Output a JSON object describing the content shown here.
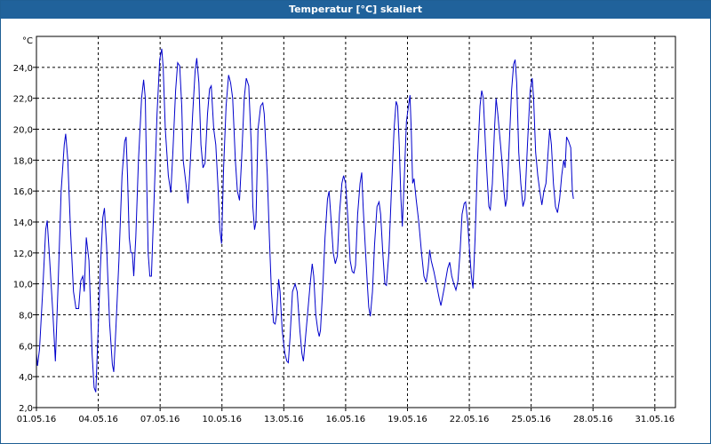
{
  "window": {
    "title": "Temperatur [°C] skaliert"
  },
  "chart_data": {
    "type": "line",
    "title": "Temperatur [°C] skaliert",
    "unit_label": "°C",
    "xlabel": "",
    "ylabel": "°C",
    "ylim": [
      2,
      26
    ],
    "xlim_days": [
      0,
      31
    ],
    "grid": true,
    "line_color": "#0000cc",
    "y_ticks": [
      "2,0",
      "4,0",
      "6,0",
      "8,0",
      "10,0",
      "12,0",
      "14,0",
      "16,0",
      "18,0",
      "20,0",
      "22,0",
      "24,0"
    ],
    "x_ticks": [
      {
        "day": 0,
        "label": "01.05.16"
      },
      {
        "day": 3,
        "label": "04.05.16"
      },
      {
        "day": 6,
        "label": "07.05.16"
      },
      {
        "day": 9,
        "label": "10.05.16"
      },
      {
        "day": 12,
        "label": "13.05.16"
      },
      {
        "day": 15,
        "label": "16.05.16"
      },
      {
        "day": 18,
        "label": "19.05.16"
      },
      {
        "day": 21,
        "label": "22.05.16"
      },
      {
        "day": 24,
        "label": "25.05.16"
      },
      {
        "day": 27,
        "label": "28.05.16"
      },
      {
        "day": 30,
        "label": "31.05.16"
      }
    ],
    "series": [
      {
        "points": [
          [
            0.0,
            5.5
          ],
          [
            0.05,
            4.7
          ],
          [
            0.15,
            5.8
          ],
          [
            0.3,
            9.5
          ],
          [
            0.45,
            13.5
          ],
          [
            0.52,
            14.1
          ],
          [
            0.62,
            12.0
          ],
          [
            0.8,
            8.0
          ],
          [
            0.92,
            5.0
          ],
          [
            1.05,
            10.0
          ],
          [
            1.2,
            16.0
          ],
          [
            1.35,
            19.0
          ],
          [
            1.42,
            19.7
          ],
          [
            1.52,
            18.0
          ],
          [
            1.65,
            13.5
          ],
          [
            1.8,
            9.5
          ],
          [
            1.92,
            8.4
          ],
          [
            2.05,
            8.4
          ],
          [
            2.15,
            10.2
          ],
          [
            2.25,
            10.5
          ],
          [
            2.32,
            9.5
          ],
          [
            2.42,
            13.0
          ],
          [
            2.55,
            11.5
          ],
          [
            2.7,
            5.5
          ],
          [
            2.8,
            3.3
          ],
          [
            2.88,
            3.0
          ],
          [
            2.98,
            6.5
          ],
          [
            3.1,
            11.0
          ],
          [
            3.22,
            14.3
          ],
          [
            3.3,
            14.9
          ],
          [
            3.4,
            12.5
          ],
          [
            3.55,
            7.5
          ],
          [
            3.68,
            4.8
          ],
          [
            3.75,
            4.3
          ],
          [
            3.85,
            7.0
          ],
          [
            4.0,
            11.5
          ],
          [
            4.15,
            17.0
          ],
          [
            4.28,
            19.2
          ],
          [
            4.35,
            19.5
          ],
          [
            4.42,
            17.0
          ],
          [
            4.5,
            13.0
          ],
          [
            4.58,
            12.0
          ],
          [
            4.65,
            12.0
          ],
          [
            4.72,
            10.5
          ],
          [
            4.82,
            13.0
          ],
          [
            4.95,
            18.0
          ],
          [
            5.1,
            22.0
          ],
          [
            5.2,
            23.2
          ],
          [
            5.28,
            22.0
          ],
          [
            5.35,
            16.5
          ],
          [
            5.42,
            12.0
          ],
          [
            5.5,
            10.5
          ],
          [
            5.58,
            10.5
          ],
          [
            5.72,
            16.0
          ],
          [
            5.85,
            21.0
          ],
          [
            5.98,
            24.5
          ],
          [
            6.08,
            25.2
          ],
          [
            6.15,
            24.0
          ],
          [
            6.25,
            20.0
          ],
          [
            6.4,
            17.0
          ],
          [
            6.52,
            15.9
          ],
          [
            6.62,
            18.5
          ],
          [
            6.75,
            22.5
          ],
          [
            6.85,
            24.3
          ],
          [
            6.95,
            24.1
          ],
          [
            7.05,
            21.5
          ],
          [
            7.12,
            18.0
          ],
          [
            7.25,
            16.5
          ],
          [
            7.35,
            15.2
          ],
          [
            7.45,
            17.5
          ],
          [
            7.58,
            21.0
          ],
          [
            7.7,
            23.8
          ],
          [
            7.78,
            24.6
          ],
          [
            7.88,
            23.0
          ],
          [
            7.98,
            19.0
          ],
          [
            8.08,
            17.5
          ],
          [
            8.18,
            17.8
          ],
          [
            8.3,
            21.0
          ],
          [
            8.4,
            22.6
          ],
          [
            8.48,
            22.8
          ],
          [
            8.6,
            20.0
          ],
          [
            8.7,
            19.0
          ],
          [
            8.8,
            16.5
          ],
          [
            8.9,
            13.5
          ],
          [
            8.98,
            12.6
          ],
          [
            9.08,
            17.5
          ],
          [
            9.2,
            21.5
          ],
          [
            9.32,
            23.5
          ],
          [
            9.42,
            23.0
          ],
          [
            9.52,
            22.0
          ],
          [
            9.65,
            18.0
          ],
          [
            9.75,
            16.0
          ],
          [
            9.85,
            15.4
          ],
          [
            9.95,
            18.0
          ],
          [
            10.08,
            22.0
          ],
          [
            10.18,
            23.3
          ],
          [
            10.3,
            22.8
          ],
          [
            10.42,
            19.0
          ],
          [
            10.5,
            15.0
          ],
          [
            10.58,
            13.5
          ],
          [
            10.65,
            14.0
          ],
          [
            10.75,
            20.0
          ],
          [
            10.88,
            21.5
          ],
          [
            10.98,
            21.7
          ],
          [
            11.05,
            21.0
          ],
          [
            11.2,
            17.0
          ],
          [
            11.3,
            13.0
          ],
          [
            11.4,
            9.5
          ],
          [
            11.5,
            7.5
          ],
          [
            11.58,
            7.4
          ],
          [
            11.65,
            8.0
          ],
          [
            11.75,
            10.3
          ],
          [
            11.82,
            9.5
          ],
          [
            11.92,
            7.0
          ],
          [
            12.05,
            5.5
          ],
          [
            12.15,
            5.0
          ],
          [
            12.22,
            4.9
          ],
          [
            12.3,
            6.5
          ],
          [
            12.42,
            9.5
          ],
          [
            12.55,
            10.0
          ],
          [
            12.65,
            9.5
          ],
          [
            12.78,
            7.0
          ],
          [
            12.88,
            5.5
          ],
          [
            12.95,
            5.0
          ],
          [
            13.05,
            6.5
          ],
          [
            13.15,
            8.0
          ],
          [
            13.28,
            10.0
          ],
          [
            13.38,
            11.3
          ],
          [
            13.45,
            10.5
          ],
          [
            13.55,
            8.0
          ],
          [
            13.65,
            7.0
          ],
          [
            13.72,
            6.6
          ],
          [
            13.78,
            7.0
          ],
          [
            13.9,
            10.0
          ],
          [
            14.0,
            13.0
          ],
          [
            14.12,
            15.5
          ],
          [
            14.2,
            16.0
          ],
          [
            14.3,
            14.0
          ],
          [
            14.4,
            12.0
          ],
          [
            14.5,
            11.3
          ],
          [
            14.6,
            11.8
          ],
          [
            14.7,
            14.5
          ],
          [
            14.82,
            16.5
          ],
          [
            14.9,
            17.0
          ],
          [
            15.0,
            16.5
          ],
          [
            15.12,
            14.0
          ],
          [
            15.22,
            11.5
          ],
          [
            15.32,
            10.8
          ],
          [
            15.4,
            10.7
          ],
          [
            15.48,
            11.2
          ],
          [
            15.58,
            14.5
          ],
          [
            15.7,
            16.5
          ],
          [
            15.78,
            17.2
          ],
          [
            15.85,
            15.0
          ],
          [
            15.95,
            12.5
          ],
          [
            16.05,
            10.0
          ],
          [
            16.12,
            8.5
          ],
          [
            16.2,
            7.9
          ],
          [
            16.3,
            9.5
          ],
          [
            16.4,
            12.5
          ],
          [
            16.52,
            15.0
          ],
          [
            16.62,
            15.3
          ],
          [
            16.7,
            14.5
          ],
          [
            16.8,
            12.0
          ],
          [
            16.9,
            10.0
          ],
          [
            16.98,
            9.9
          ],
          [
            17.1,
            12.0
          ],
          [
            17.22,
            16.0
          ],
          [
            17.35,
            20.0
          ],
          [
            17.45,
            21.8
          ],
          [
            17.52,
            21.5
          ],
          [
            17.6,
            19.0
          ],
          [
            17.68,
            15.5
          ],
          [
            17.75,
            13.7
          ],
          [
            17.85,
            17.0
          ],
          [
            17.95,
            20.5
          ],
          [
            18.05,
            21.5
          ],
          [
            18.12,
            22.2
          ],
          [
            18.18,
            20.0
          ],
          [
            18.25,
            16.5
          ],
          [
            18.32,
            16.8
          ],
          [
            18.42,
            15.5
          ],
          [
            18.55,
            14.0
          ],
          [
            18.68,
            12.0
          ],
          [
            18.8,
            10.5
          ],
          [
            18.9,
            10.1
          ],
          [
            19.0,
            11.0
          ],
          [
            19.08,
            12.2
          ],
          [
            19.15,
            11.5
          ],
          [
            19.28,
            10.8
          ],
          [
            19.4,
            10.0
          ],
          [
            19.55,
            9.0
          ],
          [
            19.62,
            8.6
          ],
          [
            19.72,
            9.3
          ],
          [
            19.82,
            10.0
          ],
          [
            19.95,
            11.0
          ],
          [
            20.05,
            11.4
          ],
          [
            20.15,
            10.5
          ],
          [
            20.25,
            10.0
          ],
          [
            20.35,
            9.6
          ],
          [
            20.45,
            10.2
          ],
          [
            20.55,
            12.0
          ],
          [
            20.65,
            14.5
          ],
          [
            20.75,
            15.2
          ],
          [
            20.82,
            15.3
          ],
          [
            20.92,
            14.0
          ],
          [
            21.02,
            12.0
          ],
          [
            21.1,
            10.5
          ],
          [
            21.18,
            9.7
          ],
          [
            21.28,
            13.0
          ],
          [
            21.4,
            18.0
          ],
          [
            21.52,
            21.5
          ],
          [
            21.6,
            22.5
          ],
          [
            21.68,
            22.0
          ],
          [
            21.78,
            19.0
          ],
          [
            21.88,
            16.5
          ],
          [
            21.95,
            15.0
          ],
          [
            22.02,
            14.8
          ],
          [
            22.12,
            16.5
          ],
          [
            22.22,
            20.0
          ],
          [
            22.3,
            22.0
          ],
          [
            22.38,
            21.0
          ],
          [
            22.48,
            19.5
          ],
          [
            22.58,
            18.0
          ],
          [
            22.68,
            16.0
          ],
          [
            22.75,
            15.0
          ],
          [
            22.82,
            15.5
          ],
          [
            22.92,
            18.5
          ],
          [
            23.05,
            22.5
          ],
          [
            23.15,
            24.2
          ],
          [
            23.22,
            24.5
          ],
          [
            23.3,
            23.0
          ],
          [
            23.4,
            18.5
          ],
          [
            23.5,
            16.5
          ],
          [
            23.6,
            15.0
          ],
          [
            23.7,
            15.5
          ],
          [
            23.82,
            19.0
          ],
          [
            23.95,
            22.5
          ],
          [
            24.05,
            23.3
          ],
          [
            24.12,
            22.0
          ],
          [
            24.22,
            18.5
          ],
          [
            24.32,
            17.0
          ],
          [
            24.42,
            16.0
          ],
          [
            24.52,
            15.1
          ],
          [
            24.62,
            16.0
          ],
          [
            24.72,
            16.5
          ],
          [
            24.82,
            18.5
          ],
          [
            24.9,
            20.0
          ],
          [
            24.98,
            19.0
          ],
          [
            25.08,
            16.5
          ],
          [
            25.18,
            15.0
          ],
          [
            25.28,
            14.6
          ],
          [
            25.38,
            15.5
          ],
          [
            25.48,
            17.0
          ],
          [
            25.58,
            18.0
          ],
          [
            25.65,
            17.5
          ],
          [
            25.72,
            19.5
          ],
          [
            25.82,
            19.2
          ],
          [
            25.92,
            18.8
          ],
          [
            26.0,
            16.0
          ],
          [
            26.05,
            15.5
          ]
        ]
      }
    ]
  }
}
